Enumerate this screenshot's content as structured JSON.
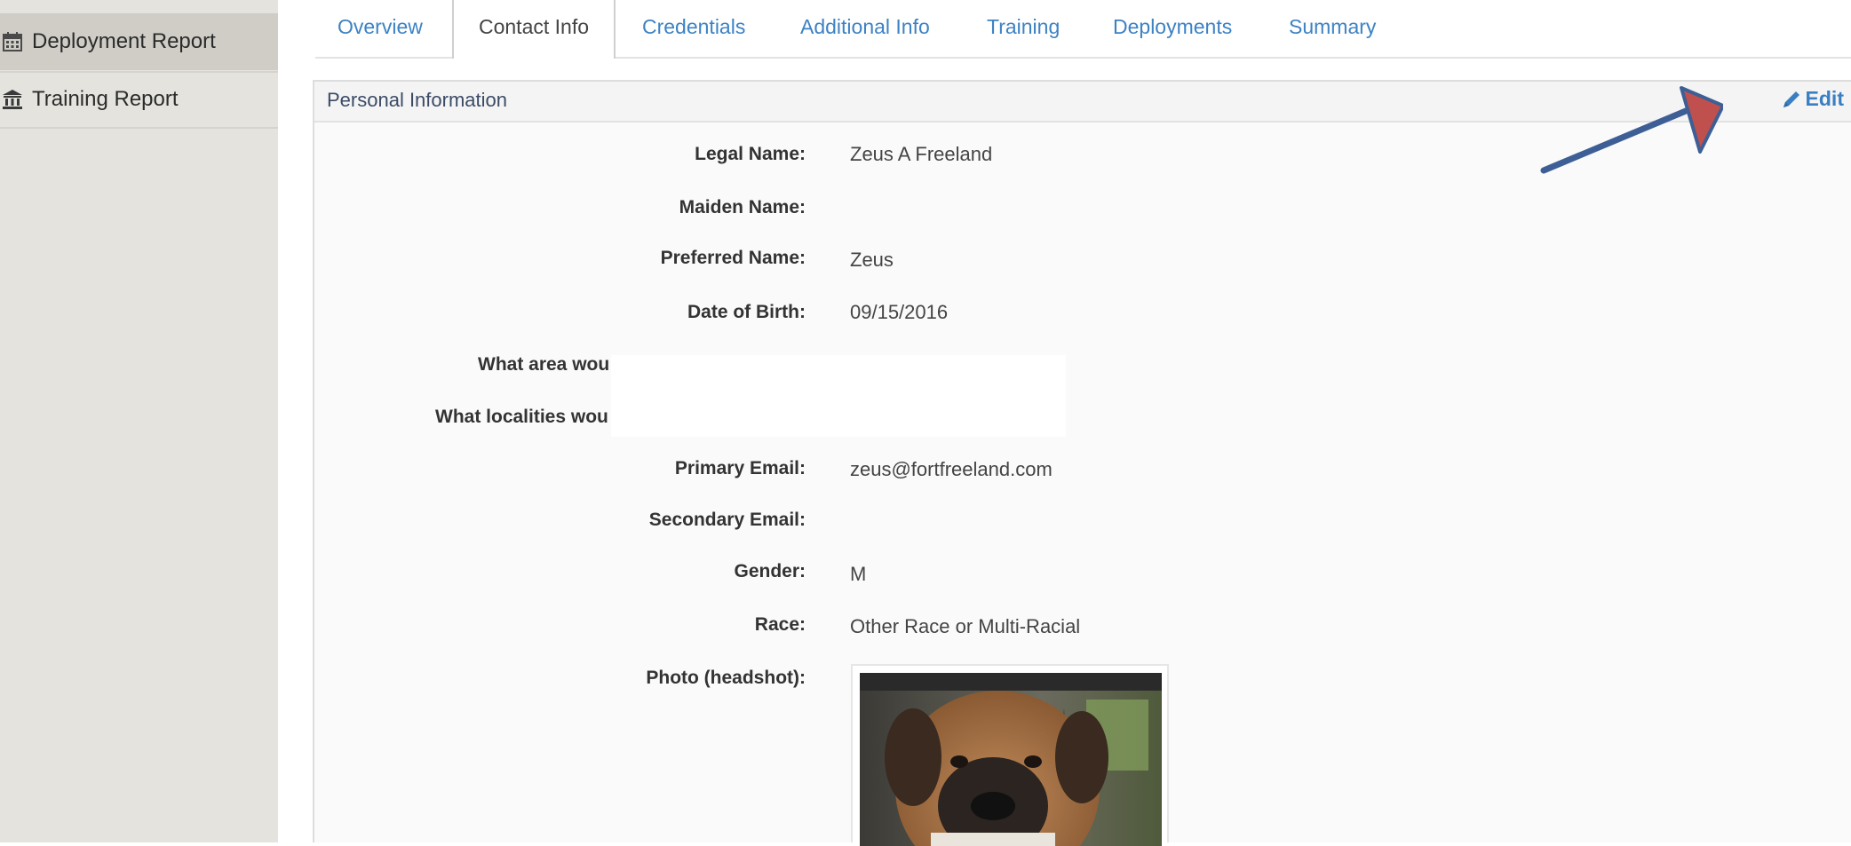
{
  "sidebar": {
    "items": [
      {
        "label": "Deployment Report",
        "icon": "calendar-icon",
        "active": true
      },
      {
        "label": "Training Report",
        "icon": "bank-icon",
        "active": false
      }
    ]
  },
  "tabs": [
    {
      "label": "Overview"
    },
    {
      "label": "Contact Info",
      "active": true
    },
    {
      "label": "Credentials"
    },
    {
      "label": "Additional Info"
    },
    {
      "label": "Training"
    },
    {
      "label": "Deployments"
    },
    {
      "label": "Summary"
    }
  ],
  "panel": {
    "title": "Personal Information",
    "edit_label": "Edit",
    "edit_icon": "pencil-icon"
  },
  "fields": {
    "legal_name": {
      "label": "Legal Name:",
      "value": "Zeus A Freeland"
    },
    "maiden_name": {
      "label": "Maiden Name:",
      "value": ""
    },
    "preferred_name": {
      "label": "Preferred Name:",
      "value": "Zeus"
    },
    "dob": {
      "label": "Date of Birth:",
      "value": "09/15/2016"
    },
    "area": {
      "label": "What area wou"
    },
    "localities": {
      "label": "What localities wou"
    },
    "primary_email": {
      "label": "Primary Email:",
      "value": "zeus@fortfreeland.com"
    },
    "secondary_email": {
      "label": "Secondary Email:",
      "value": ""
    },
    "gender": {
      "label": "Gender:",
      "value": "M"
    },
    "race": {
      "label": "Race:",
      "value": "Other Race or Multi-Racial"
    },
    "photo": {
      "label": "Photo (headshot):"
    }
  },
  "colors": {
    "link": "#3d82c4",
    "arrow_shaft": "#3d5f95",
    "arrow_head": "#c0504d"
  }
}
